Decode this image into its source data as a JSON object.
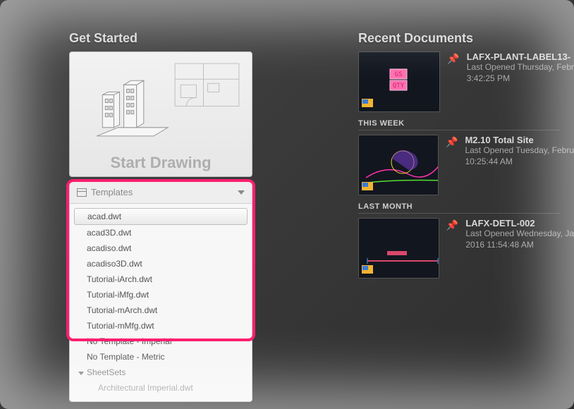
{
  "left": {
    "section_title": "Get Started",
    "start_label": "Start Drawing"
  },
  "templates": {
    "header": "Templates",
    "items": [
      {
        "label": "acad.dwt",
        "selected": true
      },
      {
        "label": "acad3D.dwt"
      },
      {
        "label": "acadiso.dwt"
      },
      {
        "label": "acadiso3D.dwt"
      },
      {
        "label": "Tutorial-iArch.dwt"
      },
      {
        "label": "Tutorial-iMfg.dwt"
      },
      {
        "label": "Tutorial-mArch.dwt"
      },
      {
        "label": "Tutorial-mMfg.dwt"
      }
    ],
    "no_template_imperial": "No Template - Imperial",
    "no_template_metric": "No Template - Metric",
    "sheetsets_label": "SheetSets",
    "sheetsets_item": "Architectural Imperial.dwt"
  },
  "recent": {
    "title": "Recent Documents",
    "groups": {
      "this_week": "THIS WEEK",
      "last_month": "LAST MONTH"
    },
    "docs": [
      {
        "name": "LAFX-PLANT-LABEL13-",
        "line1": "Last Opened Thursday, Febr",
        "line2": "3:42:25 PM",
        "thumb_tags": [
          "GS",
          "QTY"
        ]
      },
      {
        "name": "M2.10 Total Site",
        "line1": "Last Opened Tuesday, Febru",
        "line2": "10:25:44 AM"
      },
      {
        "name": "LAFX-DETL-002",
        "line1": "Last Opened Wednesday, Ja",
        "line2": "2016 11:54:48 AM"
      }
    ]
  }
}
